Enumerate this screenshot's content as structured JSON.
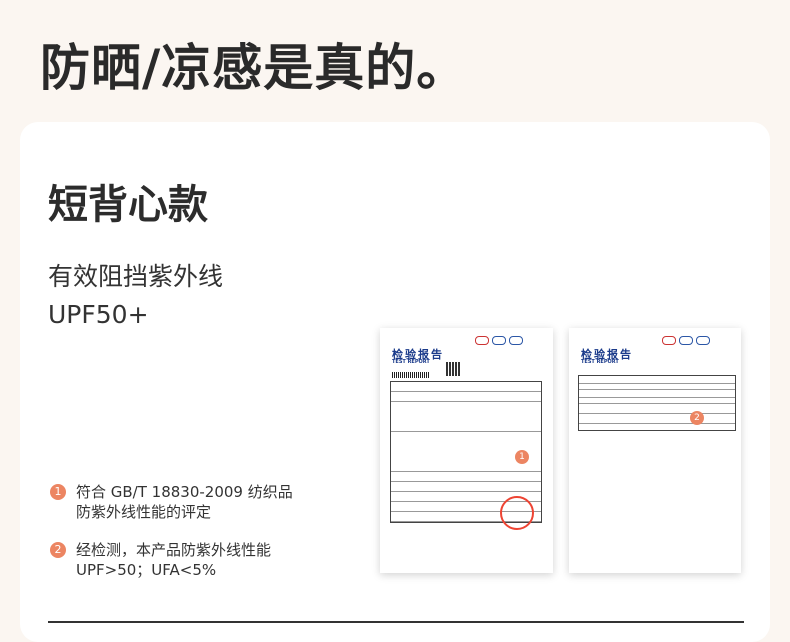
{
  "header": {
    "title": "防晒/凉感是真的。"
  },
  "section": {
    "title": "短背心款",
    "feature_line1": "有效阻挡紫外线",
    "feature_line2": "UPF50+"
  },
  "points": [
    {
      "num": "1",
      "line1": "符合 GB/T 18830-2009 纺织品",
      "line2": "防紫外线性能的评定"
    },
    {
      "num": "2",
      "line1": "经检测，本产品防紫外线性能",
      "line2": "UPF>50；UFA<5%"
    }
  ],
  "reports": [
    {
      "title": "检验报告",
      "subtitle": "TEST REPORT",
      "badge": "1"
    },
    {
      "title": "检验报告",
      "subtitle": "TEST REPORT",
      "badge": "2"
    }
  ],
  "colors": {
    "accent": "#ec8562",
    "background": "#fbf6f1",
    "card": "#ffffff"
  }
}
